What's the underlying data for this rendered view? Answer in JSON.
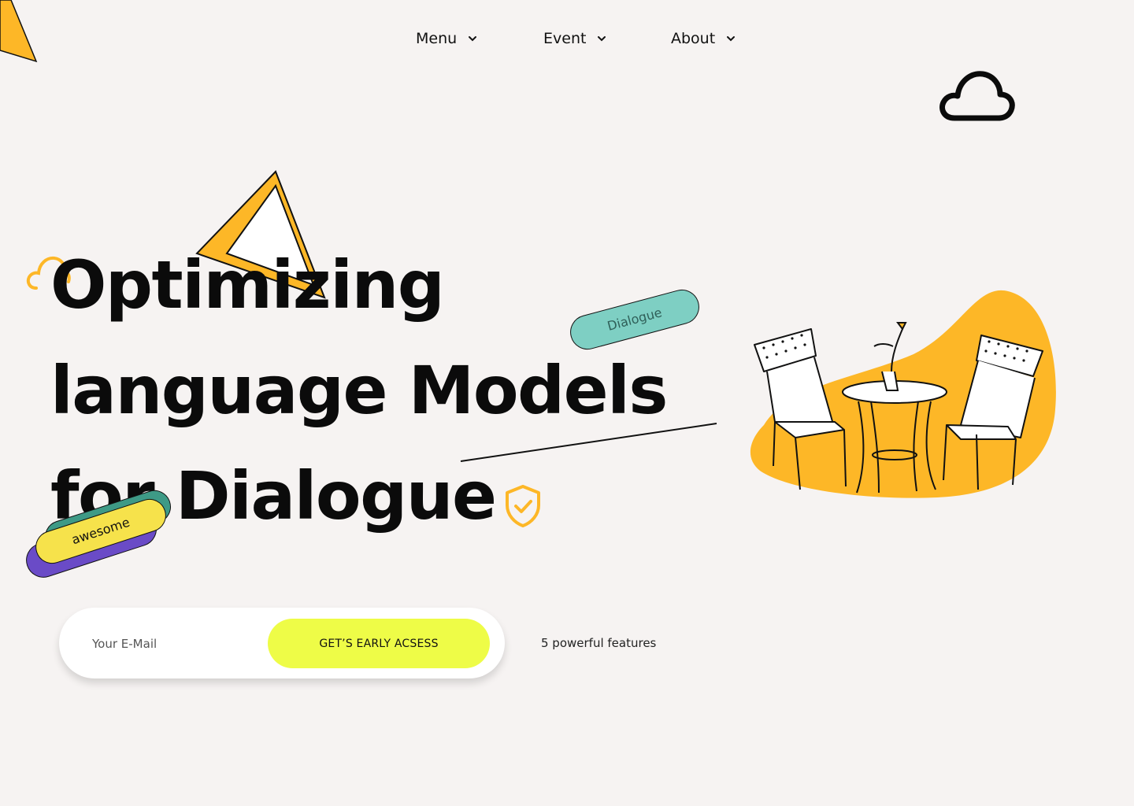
{
  "nav": {
    "items": [
      {
        "label": "Menu"
      },
      {
        "label": "Event"
      },
      {
        "label": "About"
      }
    ]
  },
  "hero": {
    "line1": "Optimizing",
    "line2": "language Models",
    "line3": "for Dialogue"
  },
  "tags": {
    "dialogue": "Dialogue",
    "awesome": "awesome"
  },
  "form": {
    "email_placeholder": "Your E-Mail",
    "cta_label": "GET’S EARLY ACSESS"
  },
  "features_text": "5 powerful features",
  "colors": {
    "background": "#f6f3f2",
    "accent_yellow": "#fdb727",
    "cta_lime": "#eefc47",
    "teal": "#7ecfc3",
    "purple": "#6a4bc7",
    "pill_yellow": "#f6e24b",
    "text": "#0b0b0b"
  },
  "icons": [
    "chevron-down-icon",
    "cloud-icon",
    "shield-check-icon",
    "triangle-shape",
    "cafe-table-illustration"
  ]
}
